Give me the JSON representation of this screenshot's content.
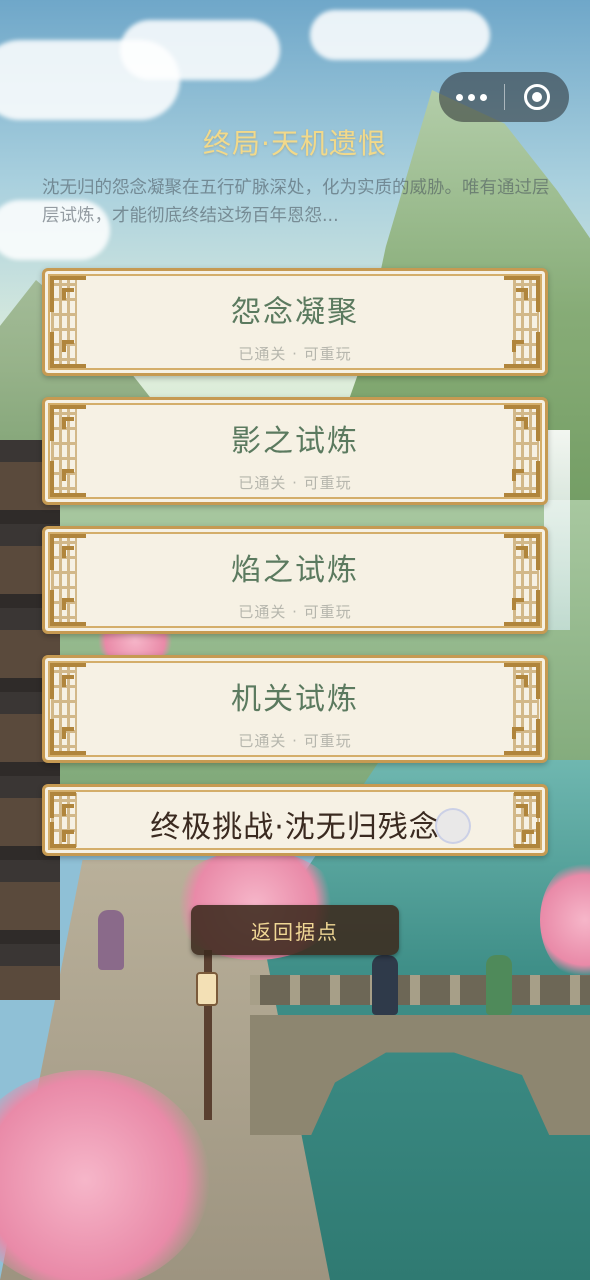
{
  "header": {
    "title": "终局·天机遗恨",
    "description": "沈无归的怨念凝聚在五行矿脉深处，化为实质的威胁。唯有通过层层试炼，才能彻底终结这场百年恩怨..."
  },
  "capsule": {
    "more_icon": "more-dots-icon",
    "close_icon": "circle-close-icon"
  },
  "stages": [
    {
      "name": "怨念凝聚",
      "status": "已通关 · 可重玩"
    },
    {
      "name": "影之试炼",
      "status": "已通关 · 可重玩"
    },
    {
      "name": "焰之试炼",
      "status": "已通关 · 可重玩"
    },
    {
      "name": "机关试炼",
      "status": "已通关 · 可重玩"
    }
  ],
  "final_challenge": {
    "name": "终极挑战·沈无归残念"
  },
  "back_button": {
    "label": "返回据点"
  },
  "colors": {
    "title_gold": "#f2d98a",
    "card_bg": "#f6f1e4",
    "card_border": "#c69a52",
    "stage_name": "#5b7a5f",
    "status_text": "#b6b6ad",
    "back_button_bg": "#3c2a1e",
    "back_button_text": "#f0d795"
  }
}
